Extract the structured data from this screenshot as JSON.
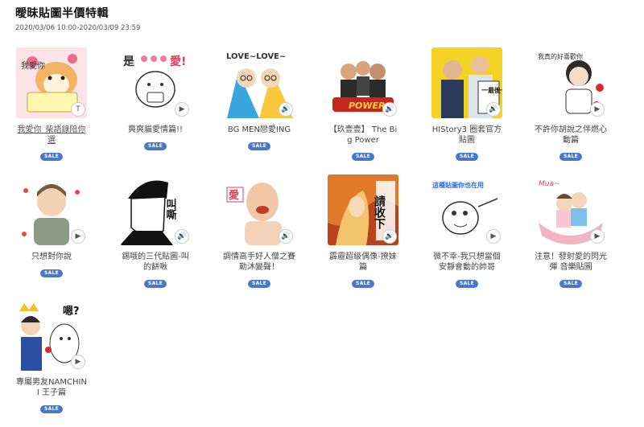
{
  "page": {
    "title": "曖昧貼圖半價特輯",
    "period": "2020/03/06 10:00-2020/03/09 23:59"
  },
  "items": [
    {
      "name": "我愛你_柴語錄陪你選",
      "badge": "T",
      "sale": "SALE"
    },
    {
      "name": "爽爽貓愛情篇!!",
      "badge": "▶",
      "sale": "SALE"
    },
    {
      "name": "BG MEN戀愛ING",
      "badge": "🔊",
      "sale": "SALE"
    },
    {
      "name": "【玖壹壹】 The Big Power",
      "badge": "🔊",
      "sale": "SALE"
    },
    {
      "name": "HIStory3 圈套官方貼圖",
      "badge": "🔊",
      "sale": "SALE"
    },
    {
      "name": "不許你胡說之伴燃心動篇",
      "badge": "▶",
      "sale": "SALE"
    },
    {
      "name": "只想對你說",
      "badge": "▶",
      "sale": "SALE"
    },
    {
      "name": "錫哦的三代貼圖-叫的餅啾",
      "badge": "🔊",
      "sale": "SALE"
    },
    {
      "name": "調情高手好人僧之賽勒沐變聲！",
      "badge": "🔊",
      "sale": "SALE"
    },
    {
      "name": "霹靂超級偶像-撩妹篇",
      "badge": "🔊",
      "sale": "SALE"
    },
    {
      "name": "微不幸-我只想當個安靜會動的帥哥",
      "badge": "▶",
      "sale": "SALE"
    },
    {
      "name": "注意！發射愛的閃光彈 音樂貼圖",
      "badge": "▶",
      "sale": "SALE"
    },
    {
      "name": "專屬男友NAMCHINI 王子篇",
      "badge": "▶",
      "sale": "SALE"
    }
  ],
  "thumb_text": {
    "t1": "我愛你",
    "t2": "是",
    "t2b": "愛!",
    "t3": "LOVE~LOVE~",
    "t4": "POWER",
    "t5": "一最後一顆了",
    "t6": "我真的好喜歡你",
    "t8": "叫嘶",
    "t9": "愛",
    "t10": "請收下",
    "t11": "這種貼圖你也在用",
    "t12": "Mua~",
    "t13": "嗯?"
  }
}
